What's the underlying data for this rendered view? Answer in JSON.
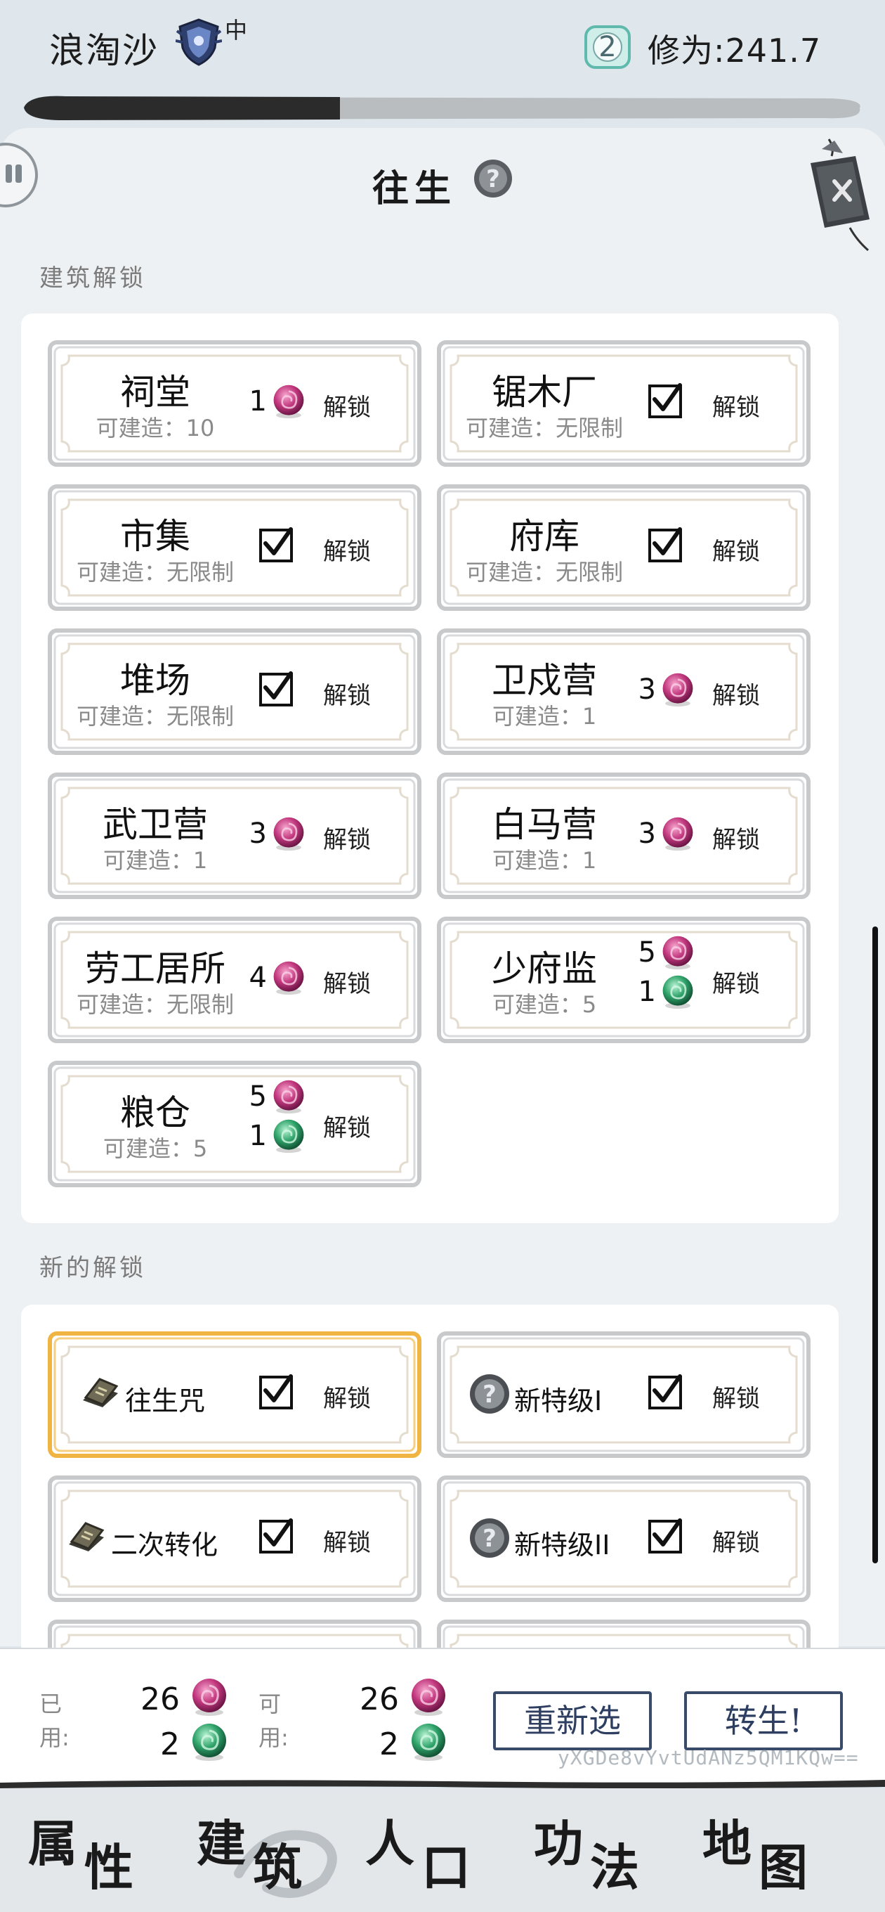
{
  "header": {
    "player_name": "浪淘沙",
    "rank_icon": "shield-crest-icon",
    "rank_level": "中",
    "coin_count": "2",
    "cultivation_label": "修为:",
    "cultivation_value": "241.7"
  },
  "panel": {
    "title": "往生",
    "help_icon": "question-icon",
    "close_icon": "close-tag-icon",
    "pause_icon": "pause-icon",
    "building_section_label": "建筑解锁",
    "new_section_label": "新的解锁"
  },
  "buildings": [
    {
      "name": "祠堂",
      "limit": "可建造：10",
      "state": "cost",
      "costs": [
        {
          "n": "1",
          "orb": "pink"
        }
      ],
      "action": "解锁"
    },
    {
      "name": "锯木厂",
      "limit": "可建造：无限制",
      "state": "unlocked",
      "action": "解锁"
    },
    {
      "name": "市集",
      "limit": "可建造：无限制",
      "state": "unlocked",
      "action": "解锁"
    },
    {
      "name": "府库",
      "limit": "可建造：无限制",
      "state": "unlocked",
      "action": "解锁"
    },
    {
      "name": "堆场",
      "limit": "可建造：无限制",
      "state": "unlocked",
      "action": "解锁"
    },
    {
      "name": "卫戍营",
      "limit": "可建造：1",
      "state": "cost",
      "costs": [
        {
          "n": "3",
          "orb": "pink"
        }
      ],
      "action": "解锁"
    },
    {
      "name": "武卫营",
      "limit": "可建造：1",
      "state": "cost",
      "costs": [
        {
          "n": "3",
          "orb": "pink"
        }
      ],
      "action": "解锁"
    },
    {
      "name": "白马营",
      "limit": "可建造：1",
      "state": "cost",
      "costs": [
        {
          "n": "3",
          "orb": "pink"
        }
      ],
      "action": "解锁"
    },
    {
      "name": "劳工居所",
      "limit": "可建造：无限制",
      "state": "cost",
      "costs": [
        {
          "n": "4",
          "orb": "pink"
        }
      ],
      "action": "解锁"
    },
    {
      "name": "少府监",
      "limit": "可建造：5",
      "state": "cost",
      "costs": [
        {
          "n": "5",
          "orb": "pink"
        },
        {
          "n": "1",
          "orb": "green"
        }
      ],
      "action": "解锁"
    },
    {
      "name": "粮仓",
      "limit": "可建造：5",
      "state": "cost",
      "costs": [
        {
          "n": "5",
          "orb": "pink"
        },
        {
          "n": "1",
          "orb": "green"
        }
      ],
      "action": "解锁"
    }
  ],
  "new_unlocks": [
    {
      "name": "往生咒",
      "icon": "book-icon",
      "state": "unlocked",
      "selected": true,
      "action": "解锁"
    },
    {
      "name": "新特级I",
      "icon": "question-icon",
      "state": "unlocked",
      "selected": false,
      "action": "解锁"
    },
    {
      "name": "二次转化",
      "icon": "book-icon",
      "state": "unlocked",
      "selected": false,
      "action": "解锁"
    },
    {
      "name": "新特级II",
      "icon": "question-icon",
      "state": "unlocked",
      "selected": false,
      "action": "解锁"
    }
  ],
  "footer": {
    "used_label": "已\n用:",
    "available_label": "可\n用:",
    "used_pink": "26",
    "used_green": "2",
    "available_pink": "26",
    "available_green": "2",
    "reselect_button": "重新选",
    "reincarnate_button": "转生!",
    "code": "yXGDe8vYvtUdANz5QM1KQw=="
  },
  "nav": [
    {
      "c1": "属",
      "c2": "性"
    },
    {
      "c1": "建",
      "c2": "筑"
    },
    {
      "c1": "人",
      "c2": "口"
    },
    {
      "c1": "功",
      "c2": "法"
    },
    {
      "c1": "地",
      "c2": "图"
    }
  ],
  "colors": {
    "pink_orb": "#c2387e",
    "green_orb": "#2fa36a",
    "selected_border": "#f0b443",
    "button_border": "#3a4a6a"
  }
}
